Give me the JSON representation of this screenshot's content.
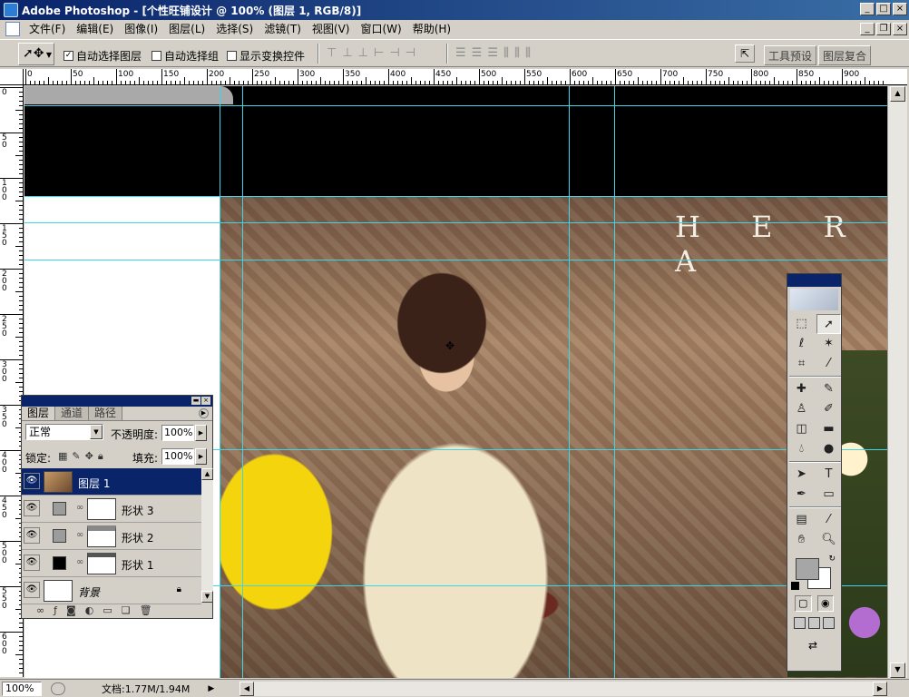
{
  "window": {
    "title": "Adobe Photoshop - [个性旺铺设计 @ 100% (图层 1, RGB/8)]",
    "controls": {
      "minimize": "_",
      "maximize": "□",
      "close": "×"
    },
    "doc_controls": {
      "minimize": "_",
      "restore": "❐",
      "close": "×"
    }
  },
  "menu": [
    "文件(F)",
    "编辑(E)",
    "图像(I)",
    "图层(L)",
    "选择(S)",
    "滤镜(T)",
    "视图(V)",
    "窗口(W)",
    "帮助(H)"
  ],
  "options": {
    "auto_select_layer": {
      "label": "自动选择图层",
      "checked": true
    },
    "auto_select_group": {
      "label": "自动选择组",
      "checked": false
    },
    "show_transform": {
      "label": "显示变换控件",
      "checked": false
    },
    "palette_well_tabs": [
      "工具预设",
      "图层复合"
    ]
  },
  "rulers": {
    "top_labels": [
      "0",
      "50",
      "100",
      "150",
      "200",
      "250",
      "300",
      "350",
      "400",
      "450",
      "500",
      "550",
      "600",
      "650",
      "700",
      "750",
      "800",
      "850",
      "900"
    ],
    "left_labels": [
      "0",
      "50",
      "100",
      "150",
      "200",
      "250",
      "300",
      "350",
      "400",
      "450",
      "500",
      "550",
      "600"
    ]
  },
  "canvas": {
    "brand_text": "H E R A"
  },
  "layers_panel": {
    "tabs": [
      "图层",
      "通道",
      "路径"
    ],
    "blend_mode": "正常",
    "opacity_label": "不透明度:",
    "opacity_value": "100%",
    "lock_label": "锁定:",
    "fill_label": "填充:",
    "fill_value": "100%",
    "layers": [
      {
        "name": "图层 1",
        "selected": true,
        "type": "image"
      },
      {
        "name": "形状 3",
        "selected": false,
        "type": "shape"
      },
      {
        "name": "形状 2",
        "selected": false,
        "type": "shape"
      },
      {
        "name": "形状 1",
        "selected": false,
        "type": "shape"
      },
      {
        "name": "背景",
        "selected": false,
        "type": "background",
        "locked": true
      }
    ]
  },
  "status": {
    "zoom": "100%",
    "doc_size": "文档:1.77M/1.94M"
  },
  "colors": {
    "guide": "#3cd6e8",
    "titlebar": "#0a246a",
    "foreground": "#a6a6a6",
    "background": "#ffffff"
  }
}
